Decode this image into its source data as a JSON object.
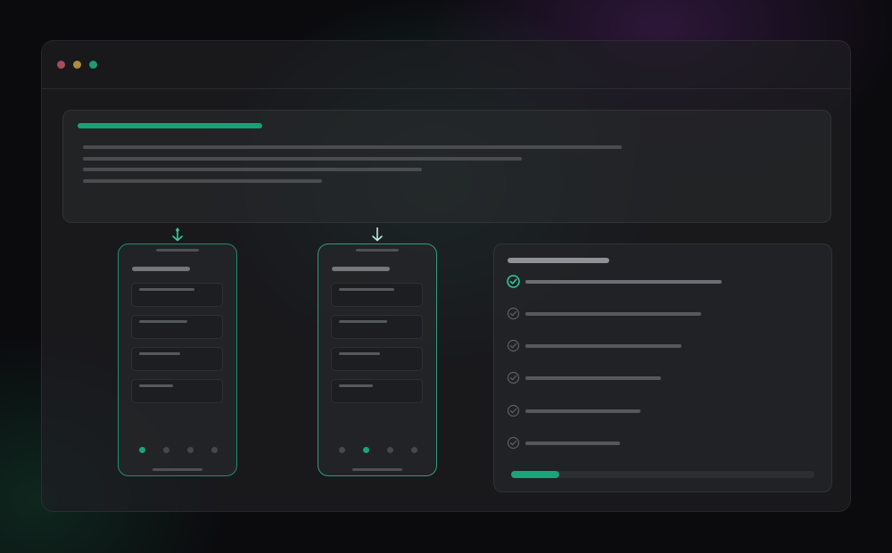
{
  "window": {
    "controls": [
      "close",
      "minimize",
      "maximize"
    ],
    "colors": {
      "close": "#a84b5e",
      "minimize": "#b08b3b",
      "maximize": "#1d9b74"
    }
  },
  "header_card": {
    "title_placeholder": true,
    "text_lines": 4
  },
  "phones": [
    {
      "arrow_icon": "download-arrow-icon",
      "fields": 4,
      "pager_dots": 4,
      "active_dot": 0
    },
    {
      "arrow_icon": "download-arrow-icon",
      "fields": 4,
      "pager_dots": 4,
      "active_dot": 1
    }
  ],
  "checklist": {
    "items": [
      {
        "state": "done",
        "icon": "check-circle-icon"
      },
      {
        "state": "pending",
        "icon": "check-circle-icon"
      },
      {
        "state": "pending",
        "icon": "check-circle-icon"
      },
      {
        "state": "pending",
        "icon": "check-circle-icon"
      },
      {
        "state": "pending",
        "icon": "check-circle-icon"
      },
      {
        "state": "pending",
        "icon": "check-circle-icon"
      }
    ],
    "progress": 0.16
  },
  "colors": {
    "accent": "#16a274",
    "background": "#0b0b0e",
    "panel": "#1e1f22",
    "placeholder": "#4a4c51"
  }
}
